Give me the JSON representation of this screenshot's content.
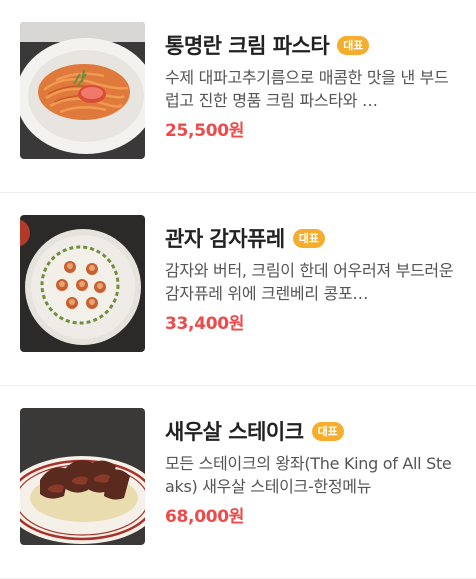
{
  "menu": {
    "items": [
      {
        "name": "통명란 크림 파스타",
        "badge": "대표",
        "description": "수제 대파고추기름으로 매콤한 맛을 낸 부드럽고 진한 명품 크림 파스타와 …",
        "price": "25,500원",
        "image_icon": "cream-pasta-photo"
      },
      {
        "name": "관자 감자퓨레",
        "badge": "대표",
        "description": "감자와 버터, 크림이 한데 어우러져 부드러운 감자퓨레 위에 크렌베리 콩포…",
        "price": "33,400원",
        "image_icon": "scallop-puree-photo"
      },
      {
        "name": "새우살 스테이크",
        "badge": "대표",
        "description": "모든 스테이크의 왕좌(The King of All Steaks) 새우살 스테이크-한정메뉴",
        "price": "68,000원",
        "image_icon": "steak-photo"
      }
    ]
  },
  "colors": {
    "badge": "#f4ad2c",
    "price": "#ee4a4a",
    "title": "#222222",
    "description": "#555555"
  }
}
